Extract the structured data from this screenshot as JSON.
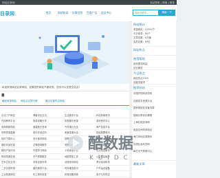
{
  "topbar": {
    "left": "网站目录网！",
    "right": "包站导航 | 搜索 | 登录"
  },
  "header": {
    "logo": "目录网",
    "nav": [
      "首页",
      "网站收录",
      "文章信息",
      "百度广告",
      "会员中心"
    ],
    "search_placeholder": "搜索关键词...",
    "search_button": "搜索一下"
  },
  "notice": "欢迎来到网站目录网站，如果您的网站不被收录，您也可以去提交站点！",
  "section": {
    "title": "最",
    "sub_links": [
      "最新收录网站",
      "网站点击排行榜",
      "最近访客热点网站"
    ]
  },
  "grid_rows": [
    [
      "企业门户网站",
      "博客论坛交流",
      "生活服务平台",
      "科技新闻资讯"
    ],
    [
      "在线教育平台",
      "旅游攻略分享",
      "影视娱乐资源",
      "游戏资讯中心"
    ],
    [
      "电商购物导航",
      "健康医疗咨询",
      "汽车报价大全",
      "房产信息平台"
    ],
    [
      "体育赛事直播",
      "音乐在线试听",
      "美食菜谱大全",
      "财经股票资讯"
    ],
    [
      "软件下载中心",
      "设计素材网站",
      "招聘求职平台",
      "母婴育儿知识"
    ],
    [
      "摄影作品欣赏",
      "法律咨询服务",
      "宠物饲养指南",
      "家居装修设计"
    ],
    [
      "数码产品评测",
      "外语学习网站",
      "小说阅读平台",
      "农业信息服务"
    ],
    [
      "物流快递查询",
      "天气预报服务",
      "地图导航工具",
      "公益慈善组织"
    ],
    [
      "艺术文化交流",
      "手机应用市场",
      "动漫资讯网站",
      "考试培训机构"
    ],
    [
      "二手交易市场",
      "婚庆服务平台",
      "时尚潮流资讯",
      "户外运动装备"
    ],
    [
      "工业制造网站",
      "化工原料信息",
      "机械设备商城",
      "电子元件供应"
    ]
  ],
  "side": {
    "stats_title": "网站统计",
    "stats": [
      "收录网站：21990个",
      "今日收录：80个",
      "文章总数：6万篇",
      "会员总数：89位"
    ],
    "hot_title": "网站热点",
    "user_title": "使用帮助",
    "user_lines": [
      "如何提交网站",
      "站长服务"
    ],
    "today_title": "今日热点",
    "today_lines": [
      "网站热点2025",
      "百度关键词"
    ],
    "rec_title": "推荐网站",
    "rec_lines": [
      "中国好的网站导航",
      "百度站长资源平台",
      "国家网络安全宣传周",
      "搜索引擎优化教程",
      "上海社保查询网",
      "免费空间申请地址",
      "海口本地实用服务",
      "中国社会科学网",
      "每日天气预报中心"
    ],
    "more_title": "最新文章"
  },
  "watermark": {
    "main": "酷数据",
    "sub": "K U I D C"
  }
}
